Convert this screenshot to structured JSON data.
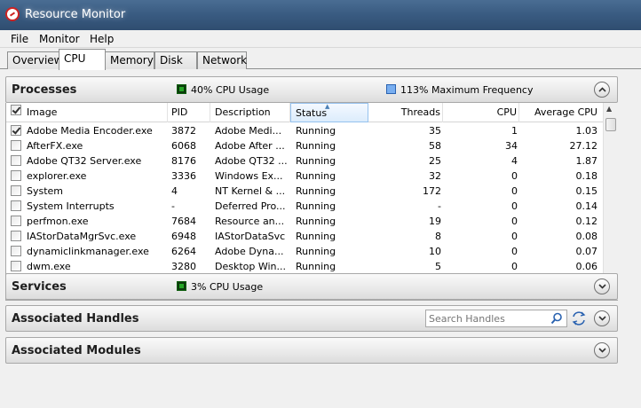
{
  "window": {
    "title": "Resource Monitor"
  },
  "menu": [
    "File",
    "Monitor",
    "Help"
  ],
  "tabs": [
    "Overview",
    "CPU",
    "Memory",
    "Disk",
    "Network"
  ],
  "processes": {
    "title": "Processes",
    "cpu_usage": "40% CPU Usage",
    "max_frequency": "113% Maximum Frequency",
    "columns": [
      "Image",
      "PID",
      "Description",
      "Status",
      "Threads",
      "CPU",
      "Average CPU"
    ],
    "rows": [
      {
        "checked": true,
        "image": "Adobe Media Encoder.exe",
        "pid": "3872",
        "description": "Adobe Medi...",
        "status": "Running",
        "threads": "35",
        "cpu": "1",
        "avg": "1.03"
      },
      {
        "checked": false,
        "image": "AfterFX.exe",
        "pid": "6068",
        "description": "Adobe After ...",
        "status": "Running",
        "threads": "58",
        "cpu": "34",
        "avg": "27.12"
      },
      {
        "checked": false,
        "image": "Adobe QT32 Server.exe",
        "pid": "8176",
        "description": "Adobe QT32 ...",
        "status": "Running",
        "threads": "25",
        "cpu": "4",
        "avg": "1.87"
      },
      {
        "checked": false,
        "image": "explorer.exe",
        "pid": "3336",
        "description": "Windows Ex...",
        "status": "Running",
        "threads": "32",
        "cpu": "0",
        "avg": "0.18"
      },
      {
        "checked": false,
        "image": "System",
        "pid": "4",
        "description": "NT Kernel & ...",
        "status": "Running",
        "threads": "172",
        "cpu": "0",
        "avg": "0.15"
      },
      {
        "checked": false,
        "image": "System Interrupts",
        "pid": "-",
        "description": "Deferred Pro...",
        "status": "Running",
        "threads": "-",
        "cpu": "0",
        "avg": "0.14"
      },
      {
        "checked": false,
        "image": "perfmon.exe",
        "pid": "7684",
        "description": "Resource an...",
        "status": "Running",
        "threads": "19",
        "cpu": "0",
        "avg": "0.12"
      },
      {
        "checked": false,
        "image": "IAStorDataMgrSvc.exe",
        "pid": "6948",
        "description": "IAStorDataSvc",
        "status": "Running",
        "threads": "8",
        "cpu": "0",
        "avg": "0.08"
      },
      {
        "checked": false,
        "image": "dynamiclinkmanager.exe",
        "pid": "6264",
        "description": "Adobe Dyna...",
        "status": "Running",
        "threads": "10",
        "cpu": "0",
        "avg": "0.07"
      },
      {
        "checked": false,
        "image": "dwm.exe",
        "pid": "3280",
        "description": "Desktop Win...",
        "status": "Running",
        "threads": "5",
        "cpu": "0",
        "avg": "0.06"
      }
    ]
  },
  "services": {
    "title": "Services",
    "cpu_usage": "3% CPU Usage"
  },
  "handles": {
    "title": "Associated Handles",
    "search_placeholder": "Search Handles"
  },
  "modules": {
    "title": "Associated Modules"
  },
  "colors": {
    "cpu_usage": "#26a626",
    "max_frequency": "#78aef0",
    "sorted_column": "#dcecfc"
  }
}
